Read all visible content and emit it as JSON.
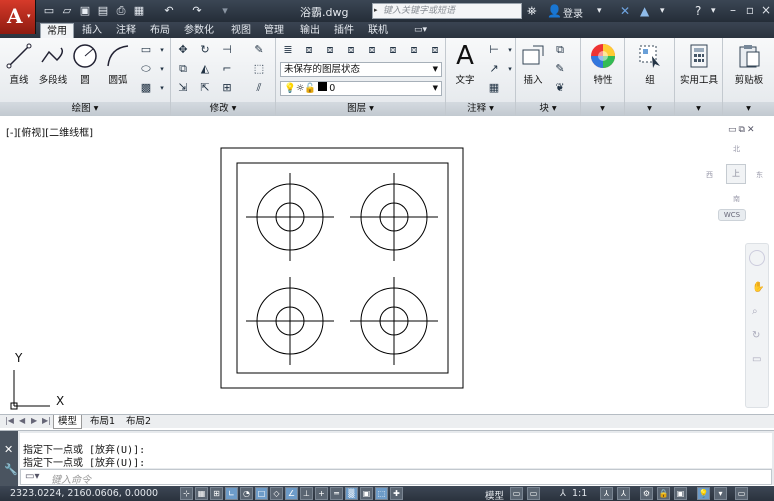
{
  "titlebar": {
    "doc_title": "浴霸.dwg",
    "search_placeholder": "键入关键字或短语",
    "login_label": "登录"
  },
  "tabs": [
    "常用",
    "插入",
    "注释",
    "布局",
    "参数化",
    "视图",
    "管理",
    "输出",
    "插件",
    "联机"
  ],
  "ribbon": {
    "draw": {
      "title": "绘图",
      "line": "直线",
      "polyline": "多段线",
      "circle": "圆",
      "arc": "圆弧"
    },
    "modify": {
      "title": "修改"
    },
    "layers": {
      "title": "图层",
      "layer_state": "未保存的图层状态",
      "current_layer": "0"
    },
    "annotation": {
      "title": "注释",
      "text": "文字"
    },
    "block": {
      "title": "块",
      "insert": "插入"
    },
    "properties": {
      "label": "特性"
    },
    "groups": {
      "label": "组"
    },
    "utilities": {
      "label": "实用工具"
    },
    "clipboard": {
      "label": "剪贴板"
    }
  },
  "viewport": {
    "label": "[-][俯视][二维线框]",
    "viewcube": {
      "north": "北",
      "south": "南",
      "east": "东",
      "west": "西",
      "top": "上"
    },
    "wcs": "WCS",
    "ucs_y": "Y",
    "ucs_x": "X"
  },
  "layout_tabs": [
    "模型",
    "布局1",
    "布局2"
  ],
  "command": {
    "history": [
      "指定下一点或 [放弃(U)]:",
      "指定下一点或 [放弃(U)]:"
    ],
    "input_placeholder": "键入命令"
  },
  "status": {
    "coords": "2323.0224, 2160.0606, 0.0000",
    "model_label": "模型",
    "scale": "1:1"
  }
}
